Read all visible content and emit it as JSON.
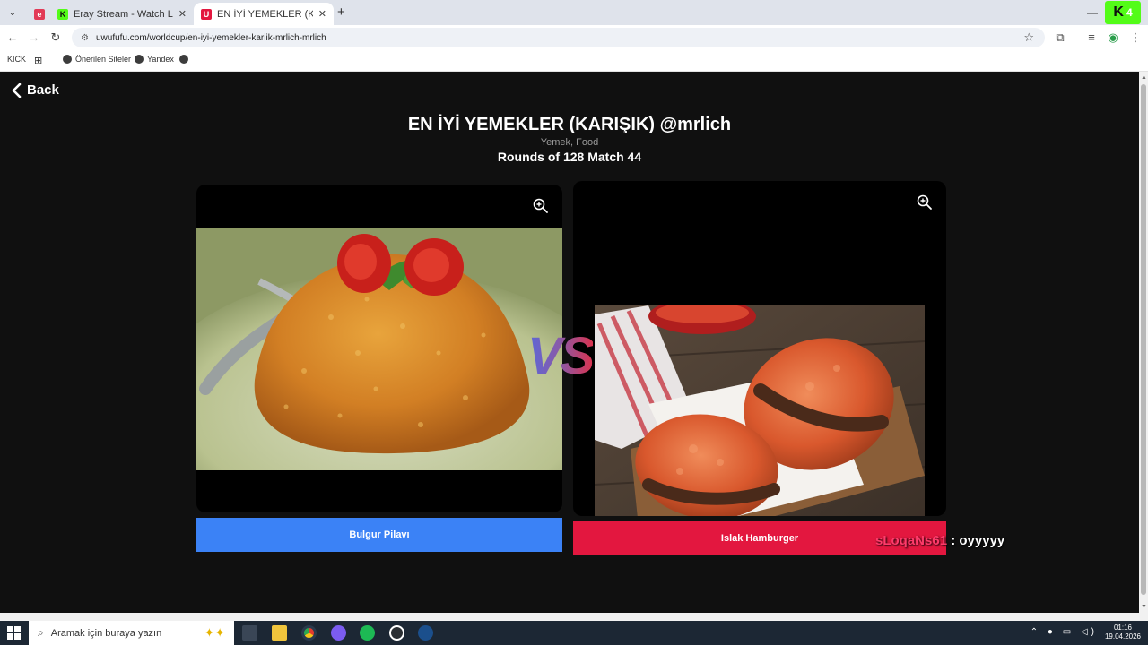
{
  "browser": {
    "tabs": [
      {
        "title": "",
        "favicon_color": "#e23a56",
        "favicon_glyph": "e"
      },
      {
        "title": "Eray Stream - Watch Live on Kick",
        "favicon_color": "#53fc18",
        "favicon_glyph": "K"
      },
      {
        "title": "EN İYİ YEMEKLER (KARIŞIK) @mrlich",
        "favicon_color": "#e3173f",
        "favicon_glyph": "U"
      }
    ],
    "url": "uwufufu.com/worldcup/en-iyi-yemekler-kariik-mrlich-mrlich",
    "overlay_badge": "4",
    "bookmarks": [
      "KICK",
      "Önerilen Siteler",
      "Yandex"
    ]
  },
  "page": {
    "back_label": "Back",
    "title": "EN İYİ YEMEKLER (KARIŞIK) @mrlich",
    "subtitle": "Yemek, Food",
    "round_info": "Rounds of 128 Match 44",
    "vs_label": "VS",
    "left_choice": {
      "label": "Bulgur Pilavı",
      "color": "#3b82f6"
    },
    "right_choice": {
      "label": "Islak Hamburger",
      "color": "#e3173f"
    }
  },
  "chat_overlay": {
    "user": "sLoqaNs61",
    "message": " : oyyyyy"
  },
  "taskbar": {
    "search_placeholder": "Aramak için buraya yazın",
    "time": "01:16",
    "date": "19.04.2026"
  }
}
